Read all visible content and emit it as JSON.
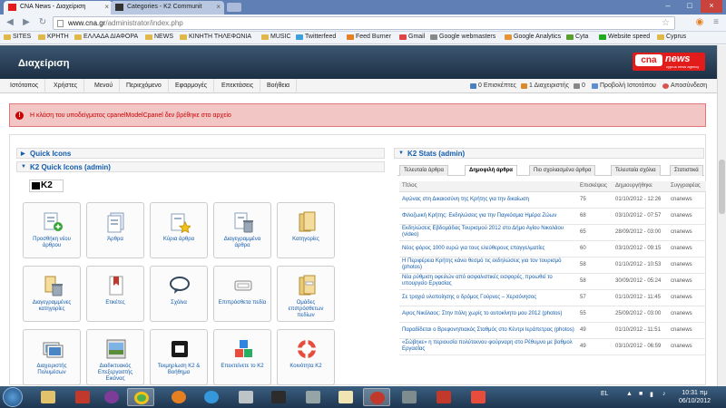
{
  "browser": {
    "tabs": [
      {
        "label": "CNA News - Διαχείριση",
        "active": true
      },
      {
        "label": "Categories - K2 Communit",
        "active": false
      }
    ],
    "url_host": "www.cna.gr",
    "url_path": "/administrator/index.php",
    "bookmarks": [
      "SITES",
      "ΚΡΗΤΗ",
      "ΕΛΛΑΔΑ ΔΙΑΦΟΡΑ",
      "NEWS",
      "ΚΙΝΗΤΗ ΤΗΛΕΦΩΝΙΑ",
      "MUSIC",
      "Twitterfeed",
      "Feed Burner",
      "Gmail",
      "Google webmasters",
      "Google Analytics",
      "Cyta",
      "Website speed",
      "Cyprus"
    ]
  },
  "admin": {
    "title": "Διαχείριση",
    "logo_left": "cna",
    "logo_right": "news",
    "logo_tag": "cyprus news agency",
    "menu": [
      "Ιστότοπος",
      "Χρήστες",
      "Μενού",
      "Περιεχόμενο",
      "Εφαρμογές",
      "Επεκτάσεις",
      "Βοήθεια"
    ],
    "status": {
      "visitors": "0 Επισκέπτες",
      "admins": "1 Διαχειριστής",
      "messages": "0",
      "view_site": "Προβολή Ιστοτόπου",
      "logout": "Αποσύνδεση"
    },
    "error_message": "Η κλάση του υποδείγματος cpanelModelCpanel δεν βρέθηκε στο αρχείο"
  },
  "left_panel": {
    "quick_icons": "Quick Icons",
    "k2_quick_icons": "K2 Quick Icons (admin)",
    "k2_logo": "K2",
    "tiles": [
      {
        "label": "Προσθήκη νέου άρθρου",
        "icon": "add-article-icon"
      },
      {
        "label": "Άρθρα",
        "icon": "articles-icon"
      },
      {
        "label": "Κύρια άρθρα",
        "icon": "featured-articles-icon"
      },
      {
        "label": "Διαγεγραμμένα άρθρα",
        "icon": "trashed-articles-icon"
      },
      {
        "label": "Κατηγορίες",
        "icon": "categories-icon"
      },
      {
        "label": "Διαγεγραμμένες κατηγορίες",
        "icon": "trashed-categories-icon"
      },
      {
        "label": "Ετικέτες",
        "icon": "tags-icon"
      },
      {
        "label": "Σχόλια",
        "icon": "comments-icon"
      },
      {
        "label": "Επιπρόσθετα πεδία",
        "icon": "extra-fields-icon"
      },
      {
        "label": "Ομάδες επιπρόσθετων πεδίων",
        "icon": "extra-field-groups-icon"
      },
      {
        "label": "Διαχειριστής Πολυμέσων",
        "icon": "media-manager-icon"
      },
      {
        "label": "Διαδικτυακός Επεξεργαστής Εικόνας",
        "icon": "image-editor-icon"
      },
      {
        "label": "Τεκμηρίωση K2 & Βοήθημα",
        "icon": "documentation-icon"
      },
      {
        "label": "Επεκτείνετε το K2",
        "icon": "extend-k2-icon"
      },
      {
        "label": "Κοινότητα K2",
        "icon": "community-icon"
      }
    ]
  },
  "stats": {
    "title": "K2 Stats (admin)",
    "tabs": [
      "Τελευταία άρθρα",
      "Δημοφιλή άρθρα",
      "Πιο σχολιασμένα άρθρα",
      "Τελευταία σχόλια",
      "Στατιστικά"
    ],
    "active_tab": 1,
    "columns": [
      "Τίτλος",
      "Επισκέψεις",
      "Δημιουργήθηκε",
      "Συγγραφέας"
    ],
    "rows": [
      {
        "title": "Αγώνας στη Δικαιοσύνη της Κρήτης για την δικαίωση",
        "hits": "75",
        "created": "01/10/2012 - 12:26",
        "author": "cnanews"
      },
      {
        "title": "Φιλοζωική Κρήτης: Εκδηλώσεις για την Παγκόσμια Ημέρα Ζώων",
        "hits": "68",
        "created": "03/10/2012 - 07:57",
        "author": "cnanews"
      },
      {
        "title": "Εκδηλώσεις Εβδομάδας Τουρισμού 2012 στο Δήμο Αγίου Νικολάου (video)",
        "hits": "65",
        "created": "28/09/2012 - 03:00",
        "author": "cnanews"
      },
      {
        "title": "Νέος φόρος 1000 ευρώ για τους ελεύθερους επαγγελματίες",
        "hits": "60",
        "created": "03/10/2012 - 09:15",
        "author": "cnanews"
      },
      {
        "title": "Η Περιφέρεια Κρήτης κάνει θεσμό τις εκδηλώσεις για τον τουρισμό (photos)",
        "hits": "58",
        "created": "01/10/2012 - 10:53",
        "author": "cnanews"
      },
      {
        "title": "Νέα ρύθμιση οφειλών από ασφαλιστικές εισφορές, προωθεί το υπουργείο Εργασίας",
        "hits": "58",
        "created": "30/09/2012 - 05:24",
        "author": "cnanews"
      },
      {
        "title": "Σε τροχιά υλοποίησης ο δρόμος Γούρνες – Χερσόνησος",
        "hits": "57",
        "created": "01/10/2012 - 11:45",
        "author": "cnanews"
      },
      {
        "title": "Αγιος Νικόλαος: Στην πόλη χωρίς το αυτοκίνητο μου 2012 (photos)",
        "hits": "55",
        "created": "25/09/2012 - 03:00",
        "author": "cnanews"
      },
      {
        "title": "Παραδίδεται ο Βρεφονηπιακός Σταθμός στο Κέντρι Ιεράπετρας (photos)",
        "hits": "49",
        "created": "01/10/2012 - 11:51",
        "author": "cnanews"
      },
      {
        "title": "«Σώβηκε» η περιουσία πολύτεκνου φούρναρη στο Ρέθυμνο με βαθμολ Εργασίας",
        "hits": "49",
        "created": "03/10/2012 - 06:59",
        "author": "cnanews"
      }
    ]
  },
  "taskbar": {
    "lang": "EL",
    "time": "10:31 πμ",
    "date": "06/10/2012"
  },
  "colors": {
    "header": "#2b4560",
    "link": "#135cae",
    "error_bg": "#f3c6c6",
    "error_text": "#cc0000",
    "logo": "#e21b1b"
  }
}
